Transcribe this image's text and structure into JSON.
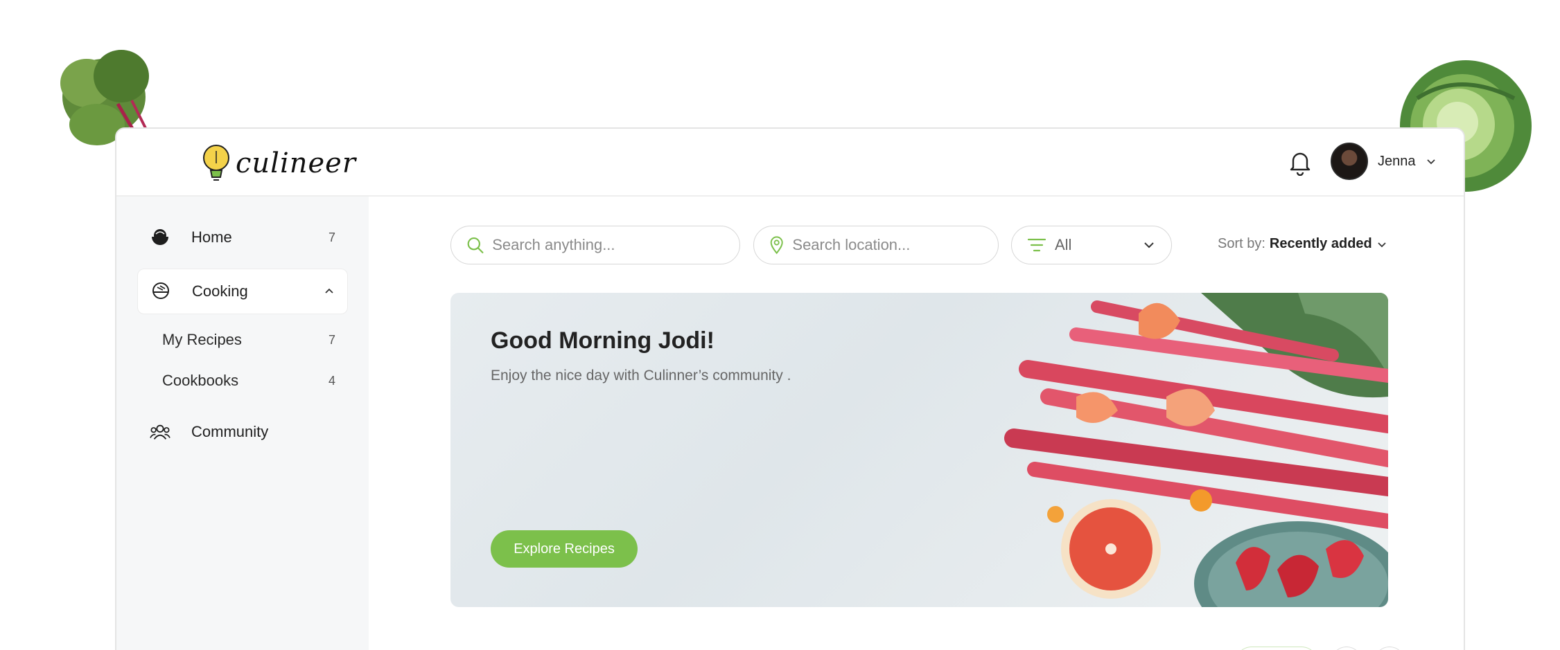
{
  "brand": {
    "name": "culineer"
  },
  "header": {
    "user_name": "Jenna",
    "icons": {
      "notifications": "bell-icon",
      "menu": "chevron-down-icon"
    }
  },
  "sidebar": {
    "items": [
      {
        "label": "Home",
        "count": "7",
        "icon": "bowl-icon"
      },
      {
        "label": "Cooking",
        "icon": "cooking-bowl-icon",
        "expanded": true,
        "children": [
          {
            "label": "My Recipes",
            "count": "7"
          },
          {
            "label": "Cookbooks",
            "count": "4"
          }
        ]
      },
      {
        "label": "Community",
        "icon": "people-icon"
      }
    ]
  },
  "search": {
    "placeholder": "Search anything..."
  },
  "location": {
    "placeholder": "Search location..."
  },
  "filter": {
    "value": "All"
  },
  "sort": {
    "label": "Sort by:",
    "value": "Recently added"
  },
  "hero": {
    "title": "Good Morning Jodi!",
    "subtitle": "Enjoy the nice day with Culinner’s community .",
    "button": "Explore Recipes"
  },
  "colors": {
    "accent": "#7cc04b",
    "sidebar_bg": "#f6f7f8"
  }
}
